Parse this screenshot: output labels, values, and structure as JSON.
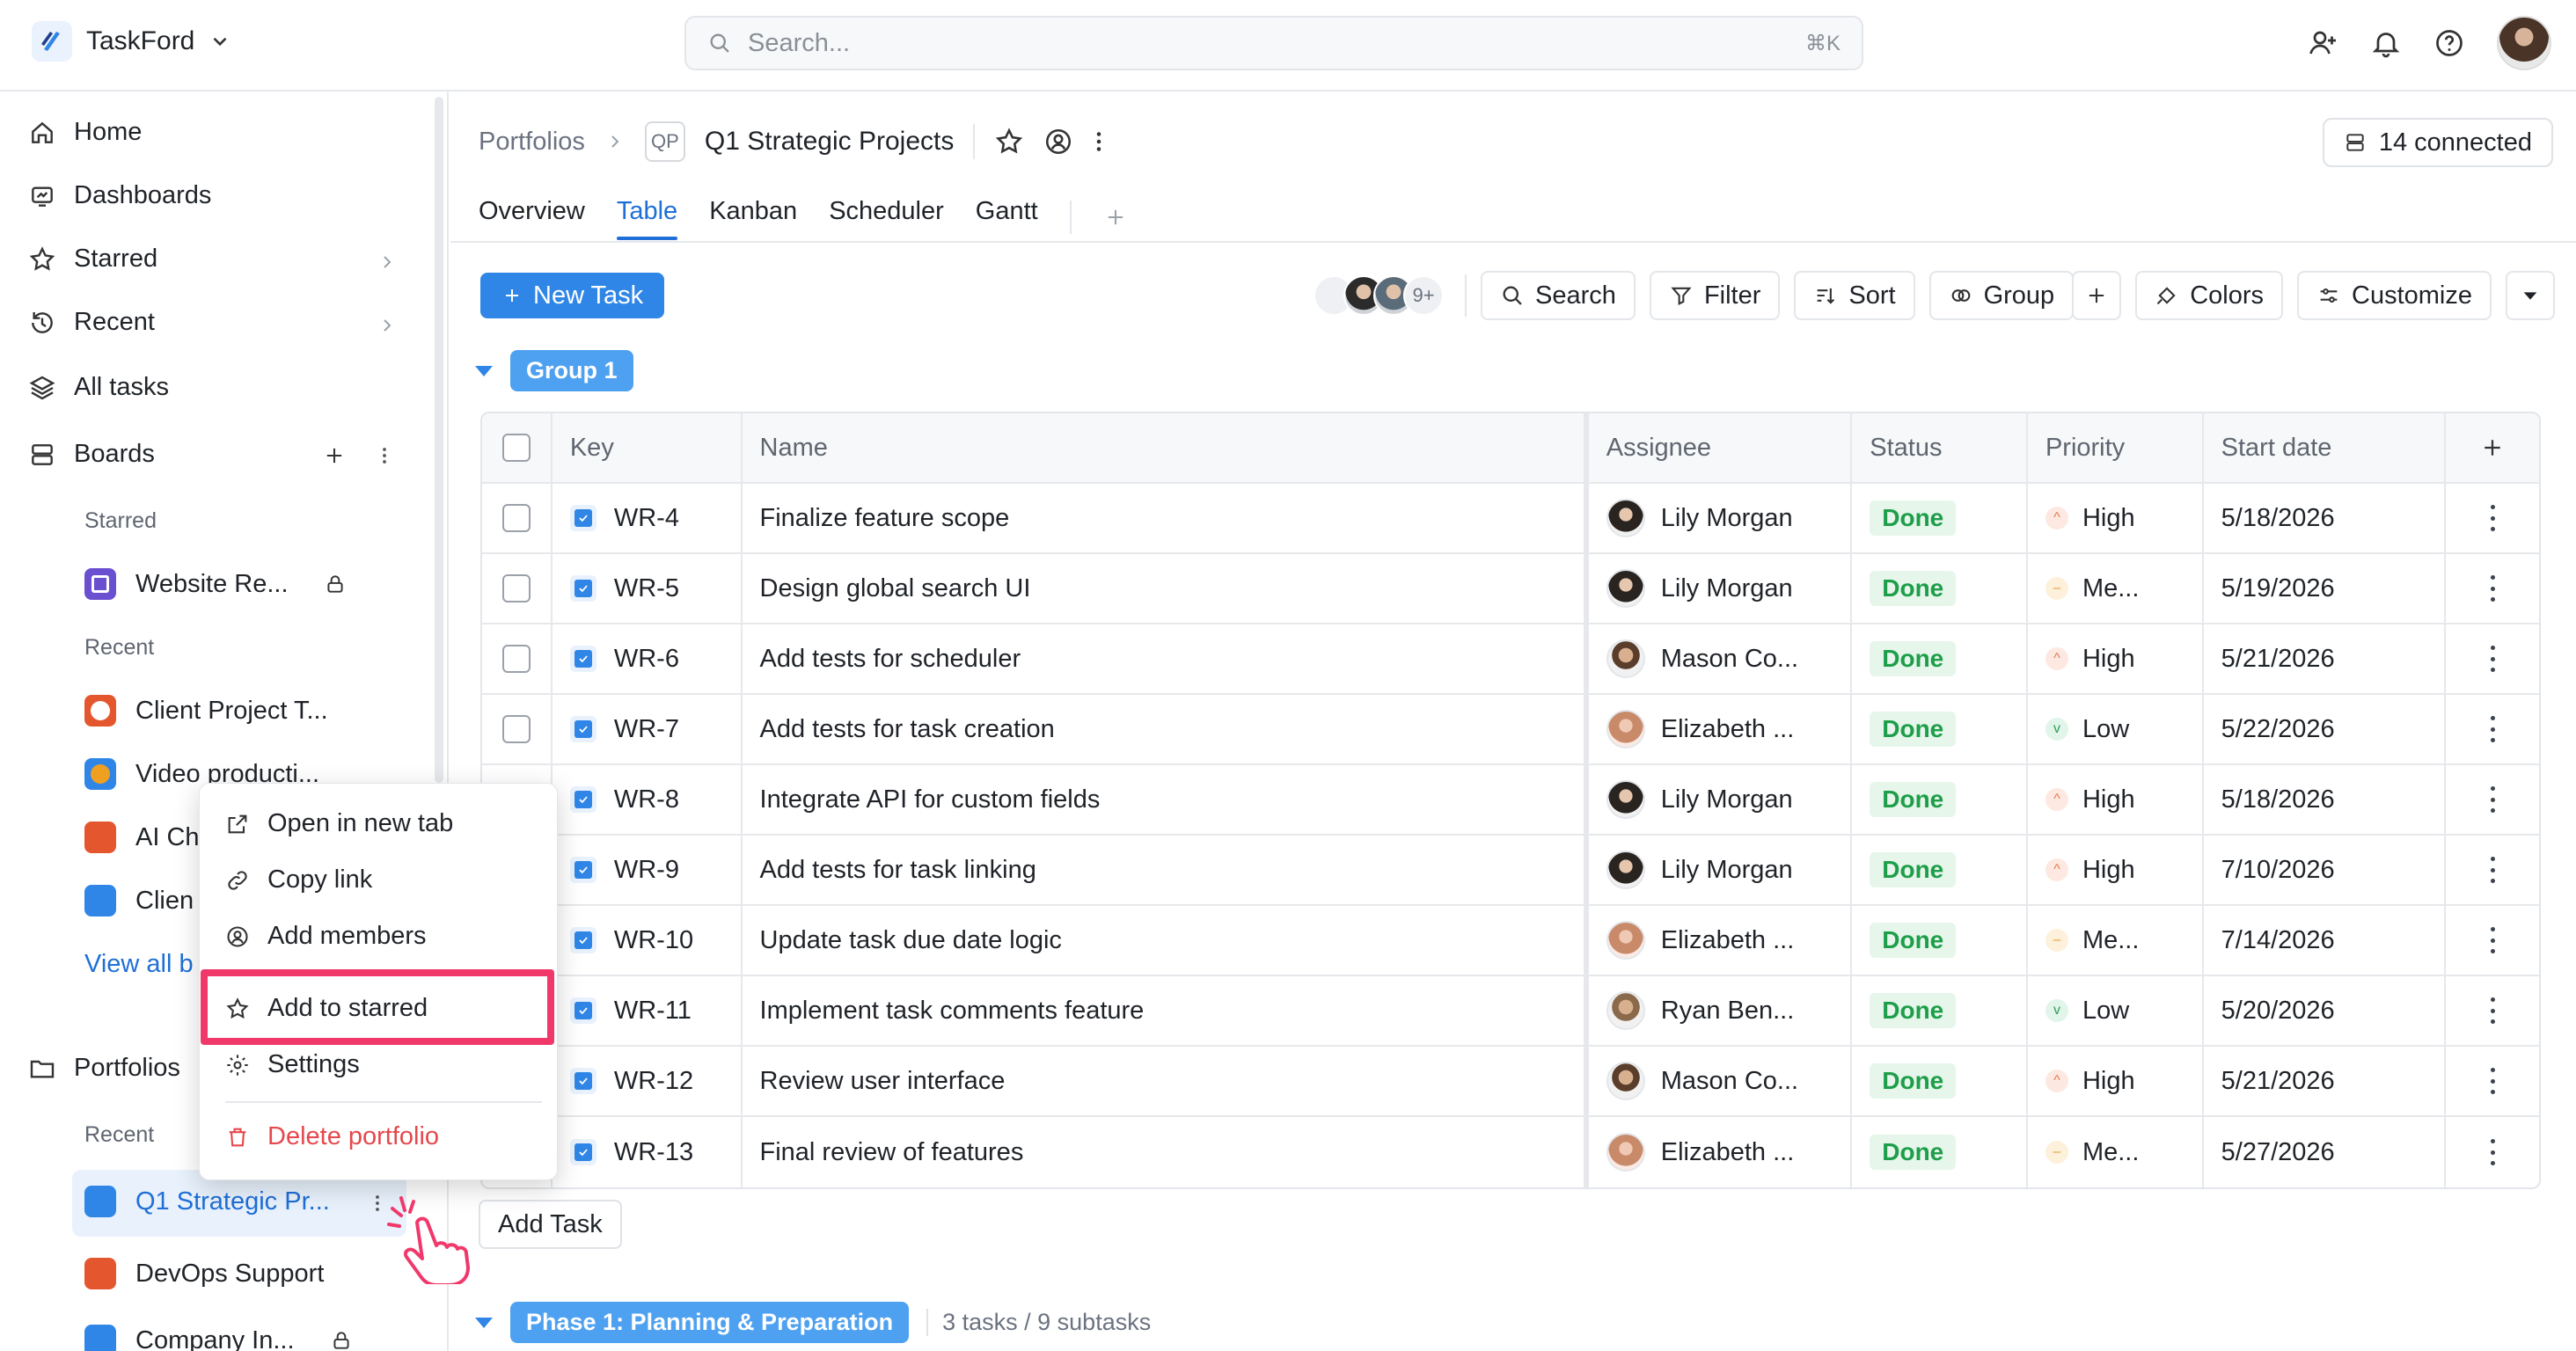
{
  "app": {
    "name": "TaskFord"
  },
  "search": {
    "placeholder": "Search...",
    "shortcut": "⌘K"
  },
  "sidebar": {
    "nav": [
      {
        "label": "Home",
        "icon": "home-icon"
      },
      {
        "label": "Dashboards",
        "icon": "dashboard-icon"
      },
      {
        "label": "Starred",
        "icon": "star-icon"
      },
      {
        "label": "Recent",
        "icon": "history-icon"
      },
      {
        "label": "All tasks",
        "icon": "layers-icon"
      },
      {
        "label": "Boards",
        "icon": "boards-icon"
      }
    ],
    "boards_starred_label": "Starred",
    "boards_starred": [
      {
        "label": "Website Re...",
        "color": "#6a4fd0",
        "locked": true
      }
    ],
    "boards_recent_label": "Recent",
    "boards_recent": [
      {
        "label": "Client Project T...",
        "color": "#e4572e"
      },
      {
        "label": "Video producti...",
        "color": "#f0a020"
      },
      {
        "label": "AI Ch",
        "color": "#e4572e"
      },
      {
        "label": "Clien",
        "color": "#2f86e6"
      }
    ],
    "view_all_label": "View all b",
    "portfolios_label": "Portfolios",
    "portfolios_recent_label": "Recent",
    "portfolios": [
      {
        "label": "Q1 Strategic Pr...",
        "color": "#2f86e6",
        "active": true
      },
      {
        "label": "DevOps Support",
        "color": "#e4572e"
      },
      {
        "label": "Company In...",
        "color": "#2f86e6",
        "locked": true
      }
    ]
  },
  "breadcrumb": {
    "root": "Portfolios",
    "badge": "QP",
    "title": "Q1 Strategic Projects"
  },
  "connected": {
    "label": "14 connected"
  },
  "tabs": [
    {
      "label": "Overview",
      "active": false
    },
    {
      "label": "Table",
      "active": true
    },
    {
      "label": "Kanban",
      "active": false
    },
    {
      "label": "Scheduler",
      "active": false
    },
    {
      "label": "Gantt",
      "active": false
    }
  ],
  "toolbar": {
    "new_task": "New Task",
    "avatars_more": "9+",
    "search": "Search",
    "filter": "Filter",
    "sort": "Sort",
    "group": "Group",
    "colors": "Colors",
    "customize": "Customize"
  },
  "group1": {
    "label": "Group 1"
  },
  "table": {
    "headers": {
      "key": "Key",
      "name": "Name",
      "assignee": "Assignee",
      "status": "Status",
      "priority": "Priority",
      "start": "Start date"
    },
    "rows": [
      {
        "key": "WR-4",
        "name": "Finalize feature scope",
        "assignee": "Lily Morgan",
        "avatar": "lily",
        "status": "Done",
        "priority": "High",
        "prio": "high",
        "start": "5/18/2026",
        "checkbox": true
      },
      {
        "key": "WR-5",
        "name": "Design global search UI",
        "assignee": "Lily Morgan",
        "avatar": "lily",
        "status": "Done",
        "priority": "Me...",
        "prio": "med",
        "start": "5/19/2026",
        "checkbox": true
      },
      {
        "key": "WR-6",
        "name": "Add tests for scheduler",
        "assignee": "Mason Co...",
        "avatar": "mason",
        "status": "Done",
        "priority": "High",
        "prio": "high",
        "start": "5/21/2026",
        "checkbox": true
      },
      {
        "key": "WR-7",
        "name": "Add tests for task creation",
        "assignee": "Elizabeth ...",
        "avatar": "eliz",
        "status": "Done",
        "priority": "Low",
        "prio": "low",
        "start": "5/22/2026",
        "checkbox": true
      },
      {
        "key": "WR-8",
        "name": "Integrate API for custom fields",
        "assignee": "Lily Morgan",
        "avatar": "lily",
        "status": "Done",
        "priority": "High",
        "prio": "high",
        "start": "5/18/2026",
        "checkbox": false
      },
      {
        "key": "WR-9",
        "name": "Add tests for task linking",
        "assignee": "Lily Morgan",
        "avatar": "lily",
        "status": "Done",
        "priority": "High",
        "prio": "high",
        "start": "7/10/2026",
        "checkbox": false
      },
      {
        "key": "WR-10",
        "name": "Update task due date logic",
        "assignee": "Elizabeth ...",
        "avatar": "eliz",
        "status": "Done",
        "priority": "Me...",
        "prio": "med",
        "start": "7/14/2026",
        "checkbox": false
      },
      {
        "key": "WR-11",
        "name": "Implement task comments feature",
        "assignee": "Ryan Ben...",
        "avatar": "ryan",
        "status": "Done",
        "priority": "Low",
        "prio": "low",
        "start": "5/20/2026",
        "checkbox": false
      },
      {
        "key": "WR-12",
        "name": "Review user interface",
        "assignee": "Mason Co...",
        "avatar": "mason",
        "status": "Done",
        "priority": "High",
        "prio": "high",
        "start": "5/21/2026",
        "checkbox": false
      },
      {
        "key": "WR-13",
        "name": "Final review of features",
        "assignee": "Elizabeth ...",
        "avatar": "eliz",
        "status": "Done",
        "priority": "Me...",
        "prio": "med",
        "start": "5/27/2026",
        "checkbox": false
      }
    ]
  },
  "add_task": "Add Task",
  "phase1": {
    "label": "Phase 1: Planning & Preparation",
    "meta": "3 tasks / 9 subtasks"
  },
  "context_menu": {
    "open_new_tab": "Open in new tab",
    "copy_link": "Copy link",
    "add_members": "Add members",
    "add_to_starred": "Add to starred",
    "settings": "Settings",
    "delete": "Delete portfolio"
  },
  "colors": {
    "accent": "#2f86e6",
    "done": "#1e9e4a",
    "danger": "#e5484d",
    "highlight": "#f0386b"
  }
}
